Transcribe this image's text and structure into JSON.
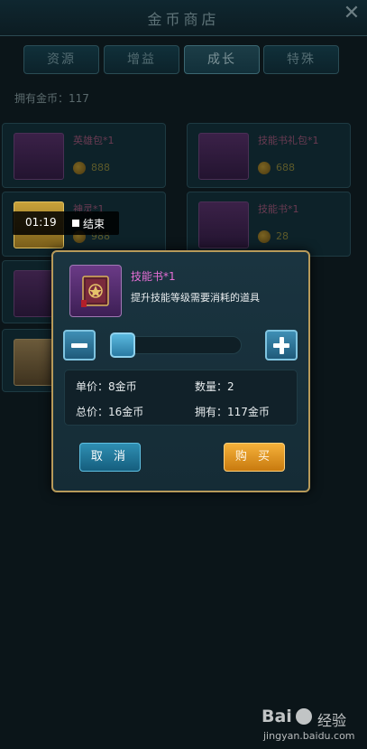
{
  "shop": {
    "title": "金币商店",
    "coins_owned": "拥有金币：117",
    "tabs": [
      {
        "label": "资源",
        "active": false
      },
      {
        "label": "增益",
        "active": false
      },
      {
        "label": "成长",
        "active": true
      },
      {
        "label": "特殊",
        "active": false
      }
    ],
    "items": [
      {
        "name": "英雄包*1",
        "price": "888"
      },
      {
        "name": "技能书礼包*1",
        "price": "688"
      },
      {
        "name": "神灵*1",
        "price": "988"
      },
      {
        "name": "技能书*1",
        "price": "28"
      }
    ]
  },
  "video": {
    "time": "01:19",
    "end_label": "结束"
  },
  "dialog": {
    "item_name": "技能书*1",
    "description": "提升技能等级需要消耗的道具",
    "slider_fraction": 0.0,
    "unit_price_label": "单价：",
    "unit_price_value": "8金币",
    "quantity_label": "数量：",
    "quantity_value": "2",
    "total_label": "总价：",
    "total_value": "16金币",
    "owned_label": "拥有：",
    "owned_value": "117金币",
    "cancel_label": "取 消",
    "buy_label": "购 买"
  },
  "watermark": {
    "brand": "Bai",
    "label": "经验",
    "url": "jingyan.baidu.com"
  },
  "colors": {
    "item_name_pink": "#e76fd6",
    "cancel_blue": "#2f8fb3",
    "buy_orange": "#f5b13a",
    "dialog_border_gold": "#b79a5a"
  }
}
